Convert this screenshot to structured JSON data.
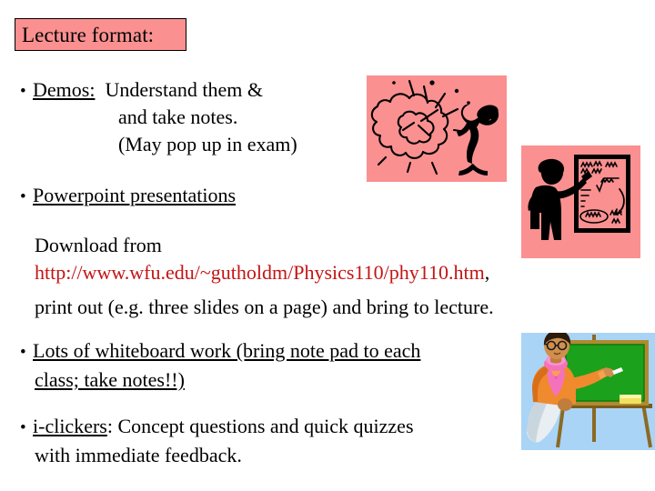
{
  "slide": {
    "title": "Lecture format:",
    "title_bg": "#fa9090",
    "title_border": "#000000"
  },
  "bullets": [
    {
      "id": "demos",
      "marker": "•",
      "lead": "Demos:",
      "lead_underlined": true,
      "lines": [
        "Understand them &",
        "and take notes.",
        "(May pop up in exam)"
      ]
    },
    {
      "id": "powerpoint",
      "marker": "•",
      "lead": "Powerpoint presentations",
      "lead_underlined": true,
      "lines": [
        "Download from",
        "http://www.wfu.edu/~gutholdm/Physics110/phy110.htm,",
        "print out (e.g. three slides on a page) and bring to lecture."
      ],
      "url_text": "http://www.wfu.edu/~gutholdm/Physics110/phy110.htm",
      "url_trailing": ",",
      "url_color": "#c41414"
    },
    {
      "id": "whiteboard",
      "marker": "•",
      "lead": "Lots of whiteboard work (bring note pad to each",
      "lead_underlined": true,
      "lines": [
        "class; take notes!!)"
      ]
    },
    {
      "id": "iclickers",
      "marker": "•",
      "lead": "i-clickers",
      "lead_underlined": true,
      "lines": [
        ":  Concept questions and quick quizzes",
        "with immediate feedback."
      ]
    }
  ],
  "text": {
    "demos_line1_rest": "Understand them &",
    "demos_line2": "and take notes.",
    "demos_line3": "(May pop up in exam)",
    "ppt_lead": "Powerpoint presentations",
    "download_from": "Download from",
    "url": "http://www.wfu.edu/~gutholdm/Physics110/phy110.htm",
    "url_comma": ",",
    "print_out": "print out (e.g. three slides on a page) and bring to lecture.",
    "wb_line1": "Lots of whiteboard work (bring note pad to each",
    "wb_line2": "class; take notes!!)",
    "ic_lead": "i-clickers",
    "ic_rest": ":  Concept questions and quick quizzes",
    "ic_line2": "with immediate feedback.",
    "demos_lead": "Demos:",
    "bullet_marker": "•"
  },
  "images": {
    "explosion": {
      "name": "demo-explosion-clipart",
      "background": "#fa9090",
      "description": "Black silhouette of a person recoiling from an exploding cloud"
    },
    "lecturer": {
      "name": "lecturer-at-whiteboard-clipart",
      "background": "#fa9090",
      "description": "Black silhouette of a presenter pointing at a whiteboard with equations"
    },
    "teacher": {
      "name": "teacher-at-chalkboard-clipart",
      "background": "#aad4f5",
      "board_color": "#1ba11b",
      "frame_color": "#b08a30",
      "description": "Teacher in orange jacket writing on a green chalkboard"
    }
  },
  "colors": {
    "pink": "#fa9090",
    "sky": "#aad4f5",
    "url_red": "#c41414",
    "text": "#000000",
    "page_bg": "#ffffff"
  }
}
